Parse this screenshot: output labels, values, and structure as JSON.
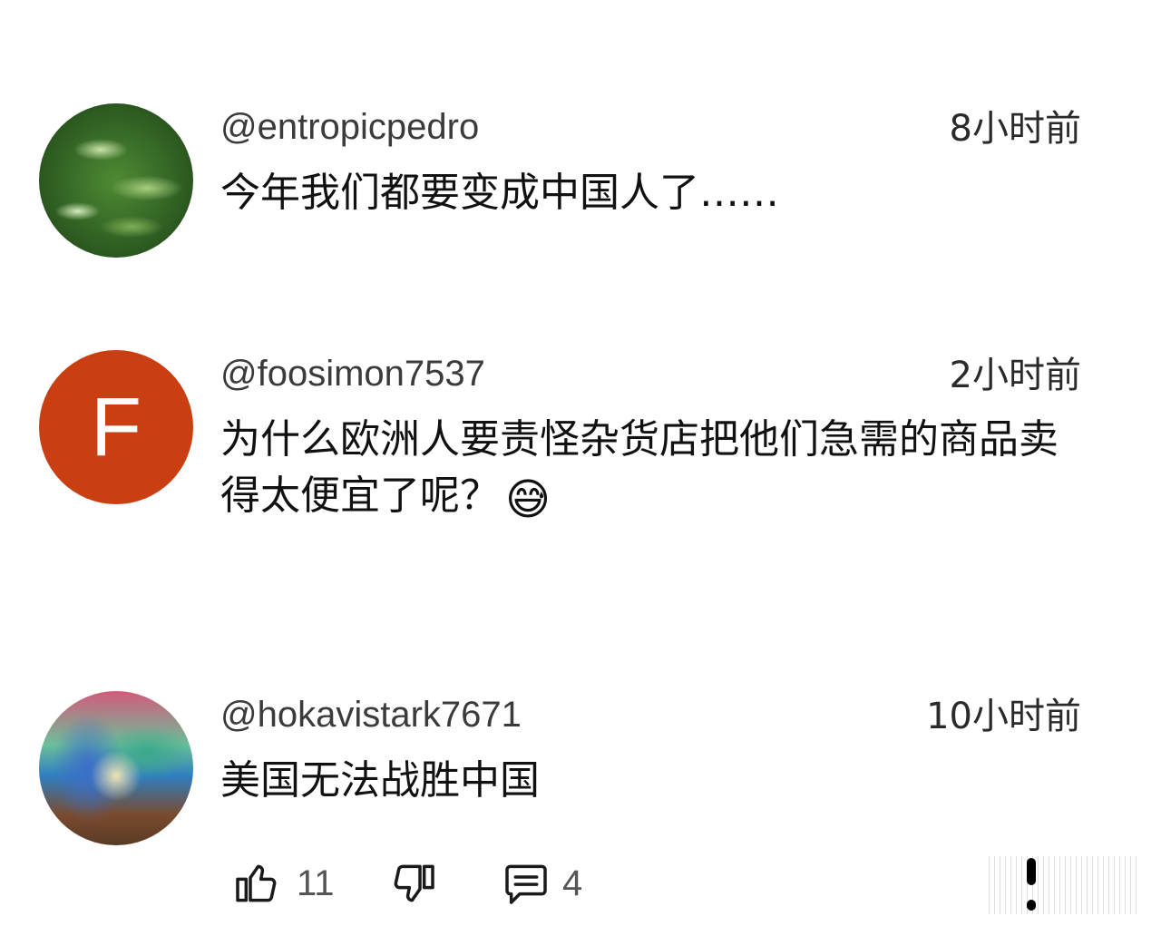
{
  "comments": [
    {
      "avatar": "leaf-photo-avatar",
      "handle": "@entropicpedro",
      "time": "8小时前",
      "text": "今年我们都要变成中国人了……"
    },
    {
      "avatar": "letter-avatar",
      "avatar_letter": "F",
      "avatar_color": "#c93f12",
      "handle": "@foosimon7537",
      "time": "2小时前",
      "text": "为什么欧洲人要责怪杂货店把他们急需的商品卖得太便宜了呢？",
      "emoji": "😅"
    },
    {
      "avatar": "album-art-avatar",
      "handle": "@hokavistark7671",
      "time": "10小时前",
      "text": "美国无法战胜中国"
    }
  ],
  "actions": {
    "like_icon": "thumbs-up-icon",
    "like_count": "11",
    "dislike_icon": "thumbs-down-icon",
    "reply_icon": "comment-icon",
    "reply_count": "4",
    "more_icon": "more-options-icon"
  }
}
